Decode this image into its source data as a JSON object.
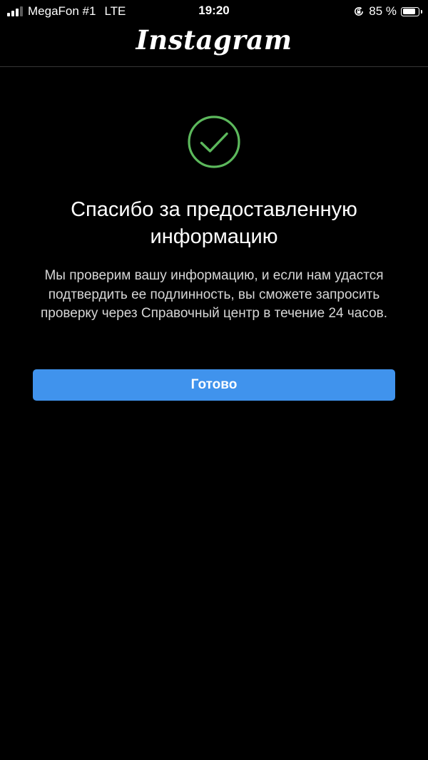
{
  "status_bar": {
    "carrier": "MegaFon #1",
    "network": "LTE",
    "time": "19:20",
    "battery_percent": "85 %",
    "battery_level": 0.85,
    "icons": [
      "signal-icon",
      "orientation-lock-icon",
      "battery-icon"
    ]
  },
  "header": {
    "logo_text": "Instagram"
  },
  "content": {
    "icon": "checkmark-circle-icon",
    "title": "Спасибо за предоставленную информацию",
    "description": "Мы проверим вашу информацию, и если нам удастся подтвердить ее подлинность, вы сможете запросить проверку через Справочный центр в течение 24 часов.",
    "button_label": "Готово"
  },
  "colors": {
    "background": "#000000",
    "accent_green": "#5cb85c",
    "button_blue": "#4093ed",
    "text_primary": "#ffffff",
    "text_secondary": "#d6d6d6"
  }
}
